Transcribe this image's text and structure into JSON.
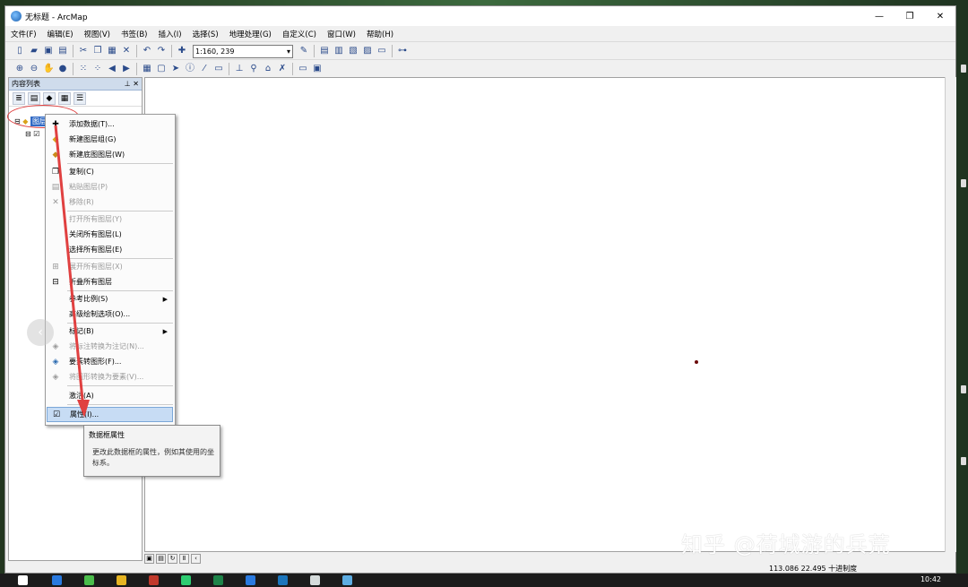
{
  "window": {
    "title": "无标题 - ArcMap",
    "buttons": [
      "—",
      "❐",
      "✕"
    ]
  },
  "menubar": [
    "文件(F)",
    "编辑(E)",
    "视图(V)",
    "书签(B)",
    "插入(I)",
    "选择(S)",
    "地理处理(G)",
    "自定义(C)",
    "窗口(W)",
    "帮助(H)"
  ],
  "toolbar": {
    "scale": "1:160, 239"
  },
  "toc": {
    "title": "内容列表",
    "pin": "⊥",
    "close": "✕",
    "layers_label": "图层"
  },
  "context_menu": [
    {
      "label": "添加数据(T)...",
      "icon": "add-data-icon",
      "glyph": "✚",
      "enabled": true
    },
    {
      "label": "新建图层组(G)",
      "icon": "group-layer-icon",
      "glyph": "◆",
      "enabled": true
    },
    {
      "label": "新建底图图层(W)",
      "icon": "basemap-icon",
      "glyph": "◆",
      "enabled": true
    },
    {
      "label": "复制(C)",
      "icon": "copy-icon",
      "glyph": "❐",
      "enabled": true
    },
    {
      "label": "粘贴图层(P)",
      "icon": "paste-icon",
      "glyph": "▤",
      "enabled": false
    },
    {
      "label": "移除(R)",
      "icon": "remove-icon",
      "glyph": "✕",
      "enabled": false
    },
    {
      "label": "打开所有图层(Y)",
      "icon": "",
      "glyph": "",
      "enabled": false
    },
    {
      "label": "关闭所有图层(L)",
      "icon": "",
      "glyph": "",
      "enabled": true
    },
    {
      "label": "选择所有图层(E)",
      "icon": "",
      "glyph": "",
      "enabled": true
    },
    {
      "label": "展开所有图层(X)",
      "icon": "expand-icon",
      "glyph": "⊞",
      "enabled": false
    },
    {
      "label": "折叠所有图层",
      "icon": "collapse-icon",
      "glyph": "⊟",
      "enabled": true
    },
    {
      "label": "参考比例(S)",
      "icon": "",
      "glyph": "",
      "enabled": true,
      "submenu": true
    },
    {
      "label": "高级绘制选项(O)...",
      "icon": "",
      "glyph": "",
      "enabled": true
    },
    {
      "label": "标记(B)",
      "icon": "",
      "glyph": "",
      "enabled": true,
      "submenu": true
    },
    {
      "label": "将标注转换为注记(N)...",
      "icon": "label-convert-icon",
      "glyph": "◈",
      "enabled": false
    },
    {
      "label": "要素转图形(F)...",
      "icon": "features-to-graphics-icon",
      "glyph": "◈",
      "enabled": true
    },
    {
      "label": "将图形转换为要素(V)...",
      "icon": "graphics-to-features-icon",
      "glyph": "◈",
      "enabled": false
    },
    {
      "label": "激活(A)",
      "icon": "",
      "glyph": "",
      "enabled": true
    },
    {
      "label": "属性(I)...",
      "icon": "properties-icon",
      "glyph": "☑",
      "enabled": true,
      "highlighted": true
    }
  ],
  "tooltip": {
    "title": "数据框属性",
    "description": "更改此数据框的属性，例如其使用的坐标系。"
  },
  "status": {
    "coords": "113.086  22.495 十进制度"
  },
  "watermark": "知乎 @荷城游的兵荒",
  "taskbar": {
    "clock": "10:42"
  },
  "colors": {
    "highlight": "#c7dcf4",
    "annotation": "#e04040",
    "toc_header": "#cfdcec"
  }
}
